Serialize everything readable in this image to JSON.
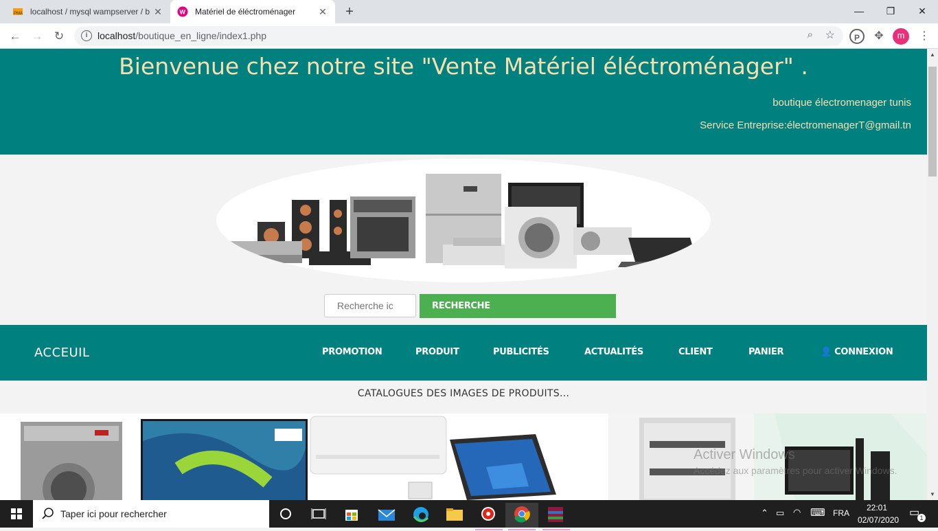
{
  "browser": {
    "tabs": [
      {
        "title": "localhost / mysql wampserver / b",
        "active": false
      },
      {
        "title": "Matériel de éléctroménager",
        "active": true
      }
    ],
    "url_host": "localhost",
    "url_path": "/boutique_en_ligne/index1.php",
    "profile_initial": "m"
  },
  "hero": {
    "title": "Bienvenue chez notre site \"Vente Matériel éléctroménager\" .",
    "subtitle1": "boutique électromenager tunis",
    "subtitle2": "Service Entreprise:électromenagerT@gmail.tn"
  },
  "search": {
    "placeholder": "Recherche ic",
    "button": "RECHERCHE"
  },
  "nav": {
    "brand": "ACCEUIL",
    "items": [
      "PROMOTION",
      "PRODUIT",
      "PUBLICITÉS",
      "ACTUALITÉS",
      "CLIENT",
      "PANIER",
      "CONNEXION"
    ]
  },
  "catalog": {
    "title": "CATALOGUES DES IMAGES DE PRODUITS..."
  },
  "watermark": {
    "line1": "Activer Windows",
    "line2": "Accédez aux paramètres pour activer Windows."
  },
  "taskbar": {
    "search_label": "Taper ici pour rechercher",
    "lang": "FRA",
    "time": "22:01",
    "date": "02/07/2020",
    "notif_count": "1"
  },
  "colors": {
    "teal": "#00807f",
    "accent_text": "#f6e0b0",
    "search_green": "#4caf50"
  }
}
